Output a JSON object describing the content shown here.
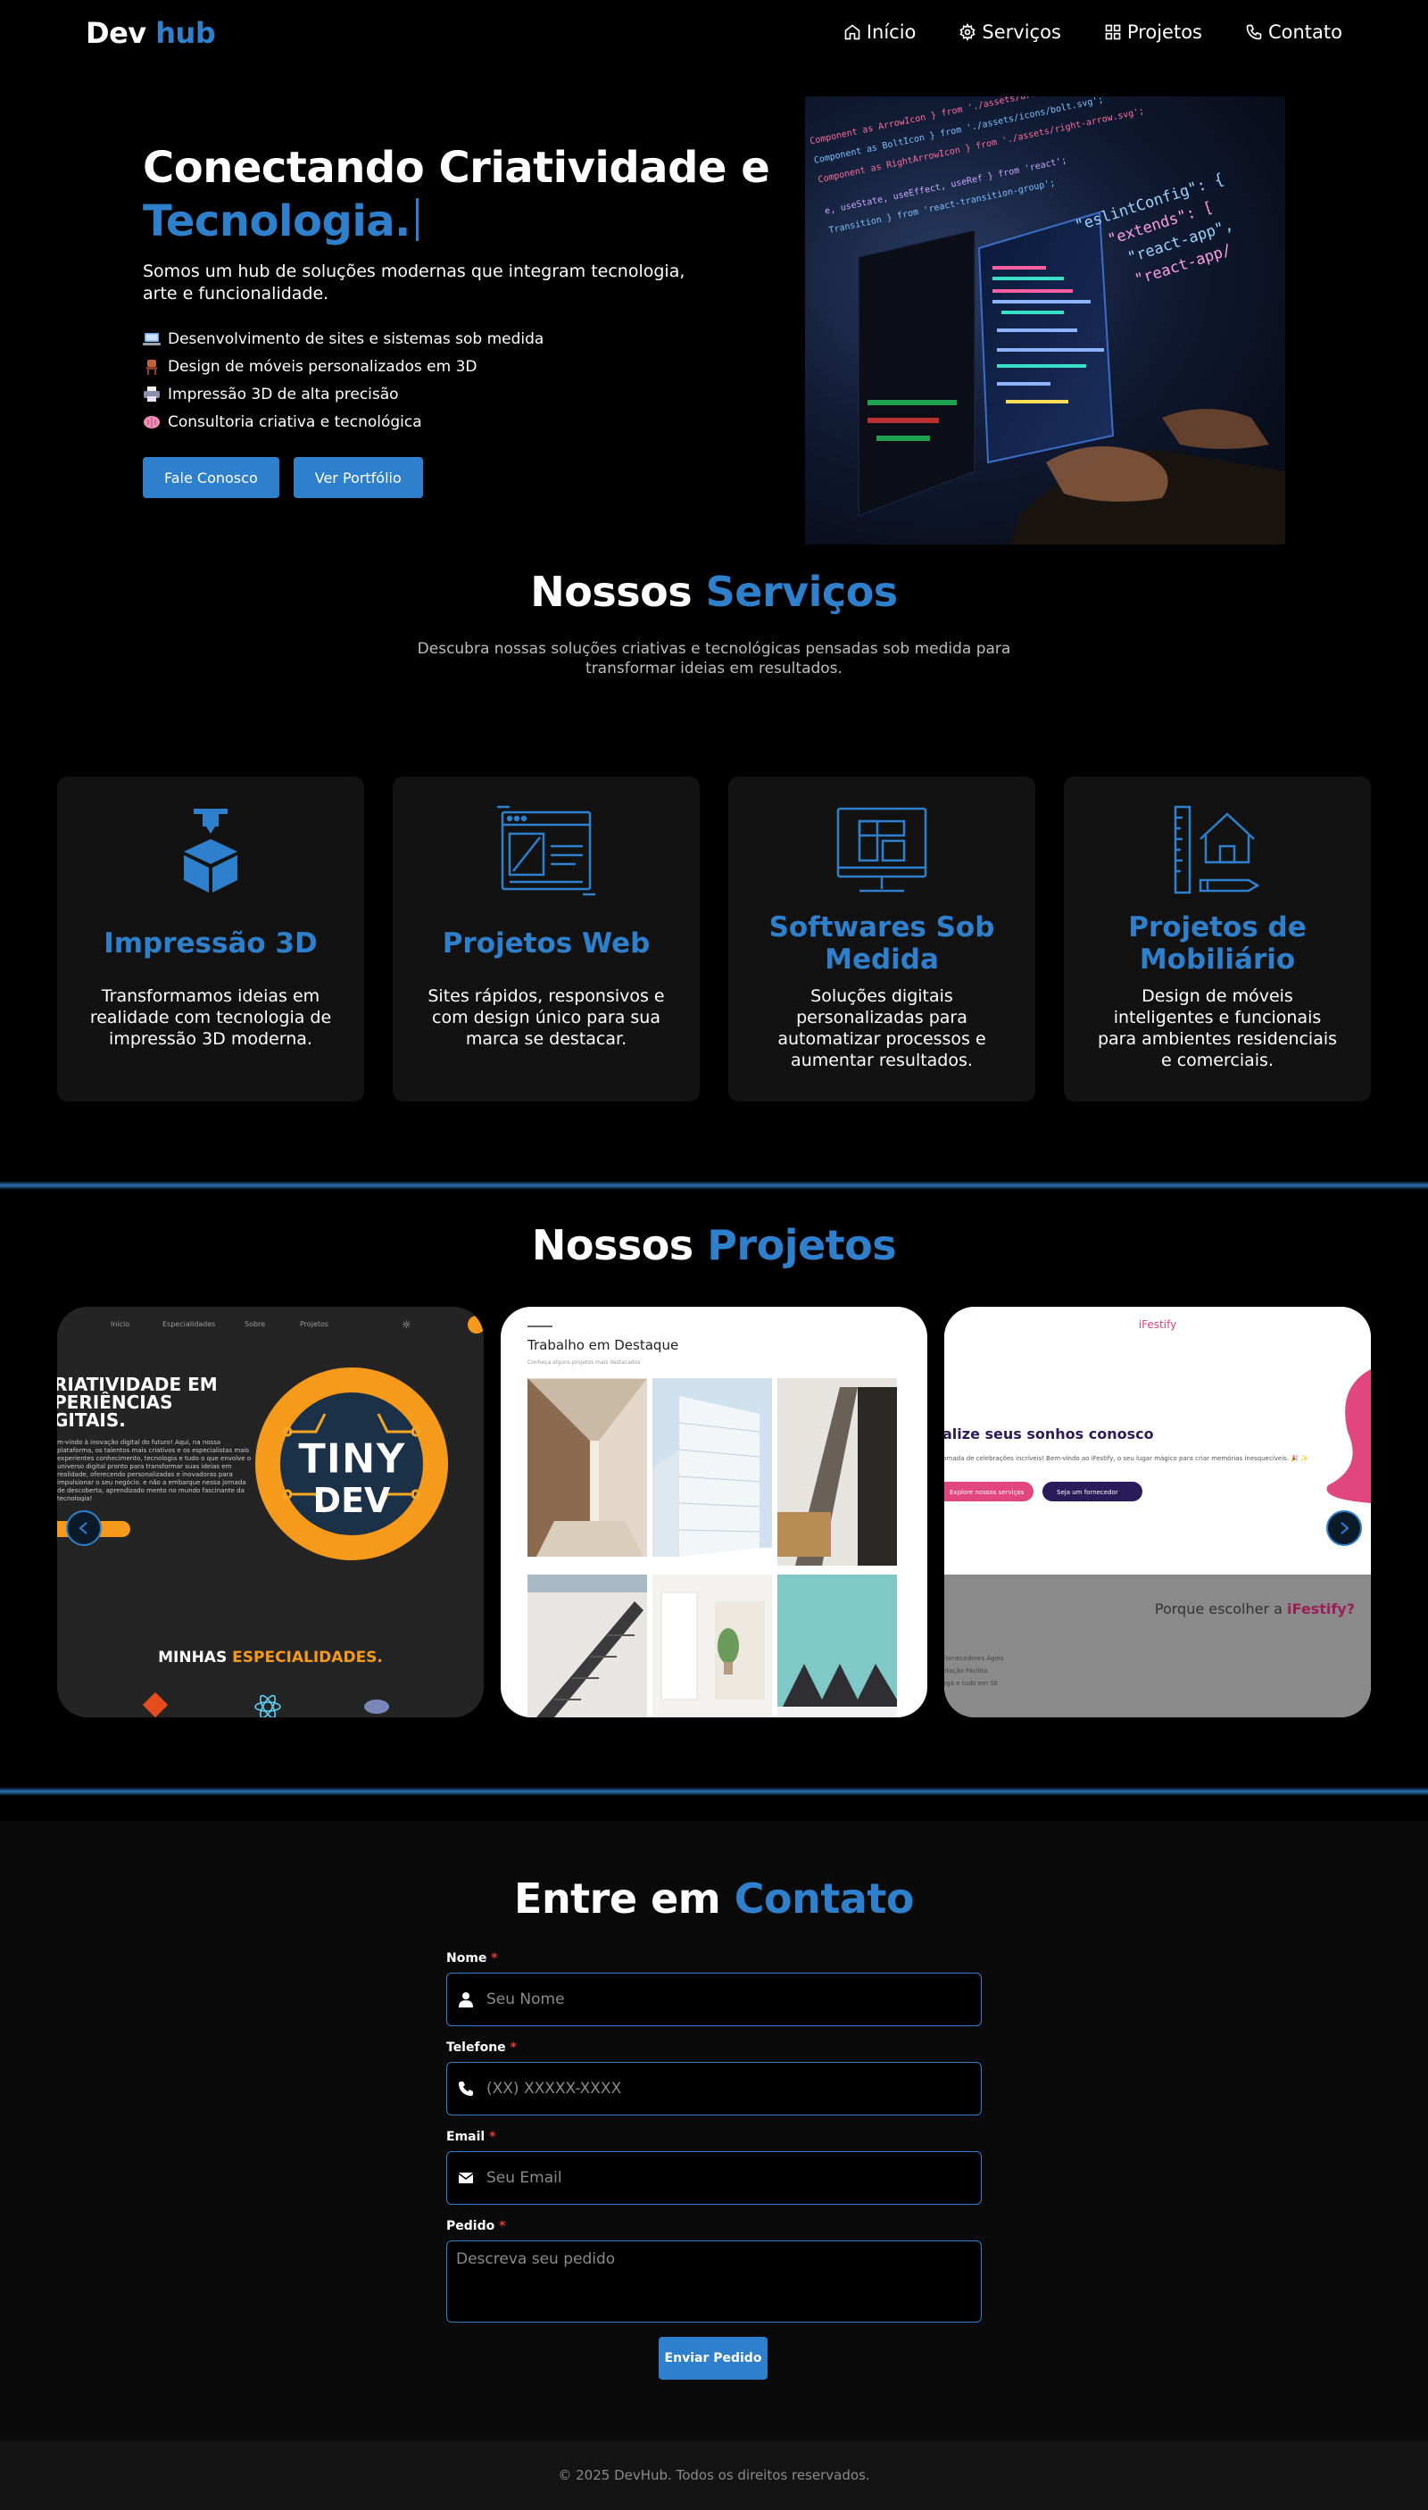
{
  "nav": {
    "logo_first": "Dev",
    "logo_second": "hub",
    "links": [
      {
        "label": "Início",
        "icon": "home-icon"
      },
      {
        "label": "Serviços",
        "icon": "gear-icon"
      },
      {
        "label": "Projetos",
        "icon": "grid-icon"
      },
      {
        "label": "Contato",
        "icon": "phone-icon"
      }
    ]
  },
  "hero": {
    "title_line1": "Conectando Criatividade e",
    "title_line2": "Tecnologia.",
    "subtitle": "Somos um hub de soluções modernas que integram tecnologia, arte e funcionalidade.",
    "features": [
      {
        "icon": "computer-emoji-icon",
        "text": "Desenvolvimento de sites e sistemas sob medida"
      },
      {
        "icon": "chair-emoji-icon",
        "text": "Design de móveis personalizados em 3D"
      },
      {
        "icon": "printer-emoji-icon",
        "text": "Impressão 3D de alta precisão"
      },
      {
        "icon": "brain-emoji-icon",
        "text": "Consultoria criativa e tecnológica"
      }
    ],
    "buttons": {
      "contact": "Fale Conosco",
      "portfolio": "Ver Portfólio"
    },
    "image_alt": "laptop-code-photo",
    "code_lines": [
      "Component as ArrowIcon } from './assets/arrow.svg';",
      "Component as BoltIcon } from './assets/icons/bolt.svg';",
      "Component as RightArrowIcon } from './assets/right-arrow.svg';",
      "e, useState, useEffect, useRef } from 'react';",
      "Transition } from 'react-transition-group';"
    ],
    "code_glow": [
      "\"eslintConfig\": {",
      "\"extends\": [",
      "\"react-app\",",
      "\"react-app/"
    ]
  },
  "services": {
    "title_first": "Nossos",
    "title_second": "Serviços",
    "subtitle": "Descubra nossas soluções criativas e tecnológicas pensadas sob medida para transformar ideias em resultados.",
    "cards": [
      {
        "icon": "3d-printer-icon",
        "title": "Impressão 3D",
        "desc": "Transformamos ideias em realidade com tecnologia de impressão 3D moderna."
      },
      {
        "icon": "web-layout-icon",
        "title": "Projetos Web",
        "desc": "Sites rápidos, responsivos e com design único para sua marca se destacar."
      },
      {
        "icon": "monitor-software-icon",
        "title": "Softwares Sob Medida",
        "desc": "Soluções digitais personalizadas para automatizar processos e aumentar resultados."
      },
      {
        "icon": "house-ruler-icon",
        "title": "Projetos de Mobiliário",
        "desc": "Design de móveis inteligentes e funcionais para ambientes residenciais e comerciais."
      }
    ]
  },
  "projects": {
    "title_first": "Nossos",
    "title_second": "Projetos",
    "slide1": {
      "nav": [
        "Início",
        "Especialidades",
        "Sobre",
        "Projetos"
      ],
      "heading": [
        "RIATIVIDADE EM",
        "PERIÊNCIAS",
        "GITAIS."
      ],
      "body": "m-vindo à inovação digital do futuro! Aqui, na nossa plataforma, os talentos mais criativos e os especialistas mais experientes conhecimento, tecnologia e tudo o que envolve o universo digital pronto para transformar suas ideias em realidade, oferecendo personalizadas e inovadoras para impulsionar o seu negócio. e não a embarque nessa jornada de descoberta, aprendizado mento no mundo fascinante da tecnologia!",
      "logo_top": "TINY",
      "logo_bottom": "DEV",
      "specialties_first": "MINHAS",
      "specialties_second": "ESPECIALIDADES."
    },
    "slide2": {
      "heading": "Trabalho em Destaque",
      "sub": "Conheça alguns projetos mais destacados"
    },
    "slide3": {
      "brand": "iFestify",
      "heading": "alize seus sonhos conosco",
      "body": "ornada de celebrações incríveis! Bem-vindo ao iFestify, o seu lugar mágico para criar memórias inesquecíveis. 🎉 ✨",
      "btn_explore": "Explore nossos serviços",
      "btn_supplier": "Seja um fornecedor",
      "why_prefix": "Porque escolher a",
      "why_brand": "iFestify?",
      "list": [
        "Fornecedores Ágeis",
        "ntação Fácilita",
        "ega e tudo em SE"
      ]
    }
  },
  "contact": {
    "title_first": "Entre em",
    "title_second": "Contato",
    "fields": {
      "name": {
        "label": "Nome",
        "placeholder": "Seu Nome"
      },
      "phone": {
        "label": "Telefone",
        "placeholder": "(XX) XXXXX-XXXX"
      },
      "email": {
        "label": "Email",
        "placeholder": "Seu Email"
      },
      "order": {
        "label": "Pedido",
        "placeholder": "Descreva seu pedido"
      }
    },
    "required_mark": "*",
    "submit": "Enviar Pedido"
  },
  "footer": {
    "text": "© 2025 DevHub. Todos os direitos reservados."
  },
  "colors": {
    "accent": "#2f80cc",
    "background": "#000000",
    "card": "#121212",
    "orange": "#f59a1b",
    "pink": "#e1467c"
  }
}
